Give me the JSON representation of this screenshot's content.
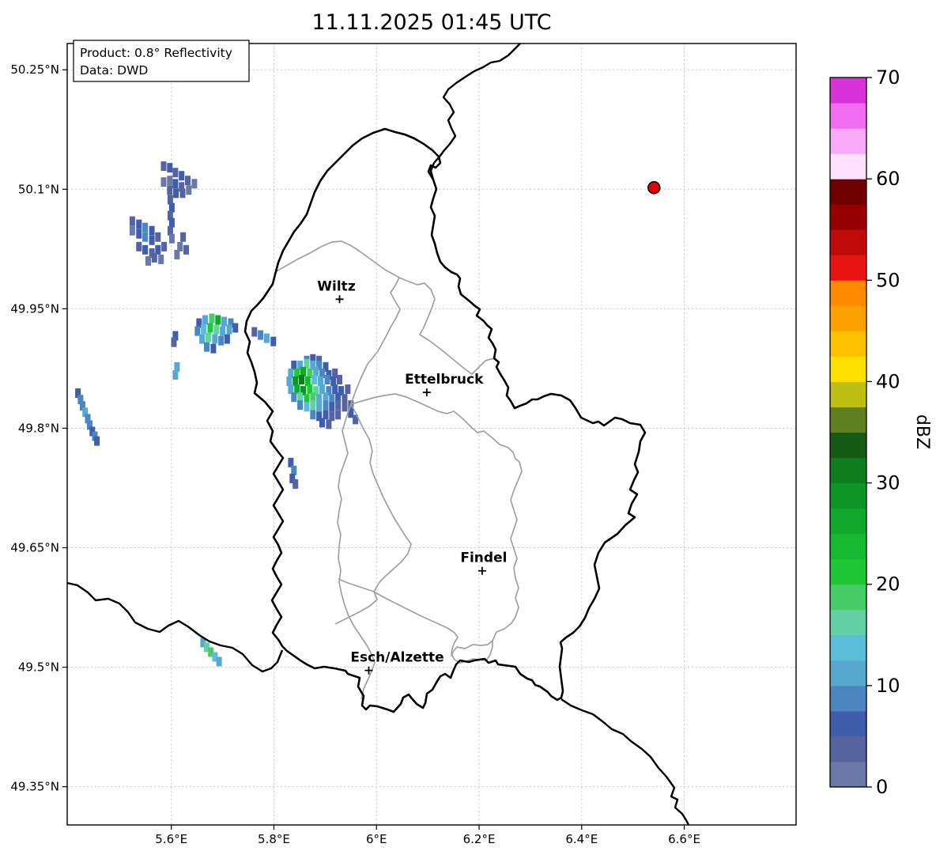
{
  "title": "11.11.2025 01:45 UTC",
  "info_box": {
    "line1": "Product: 0.8° Reflectivity",
    "line2": "Data: DWD"
  },
  "chart_data": {
    "type": "heatmap",
    "description": "Radar reflectivity map (0.8° elevation scan) over Luxembourg and surroundings",
    "axes": {
      "lon_range": [
        5.397,
        6.818
      ],
      "lat_range": [
        49.302,
        50.283
      ],
      "x_ticks": [
        {
          "value": 5.6,
          "label": "5.6°E"
        },
        {
          "value": 5.8,
          "label": "5.8°E"
        },
        {
          "value": 6.0,
          "label": "6°E"
        },
        {
          "value": 6.2,
          "label": "6.2°E"
        },
        {
          "value": 6.4,
          "label": "6.4°E"
        },
        {
          "value": 6.6,
          "label": "6.6°E"
        }
      ],
      "y_ticks": [
        {
          "value": 50.25,
          "label": "50.25°N"
        },
        {
          "value": 50.1,
          "label": "50.1°N"
        },
        {
          "value": 49.95,
          "label": "49.95°N"
        },
        {
          "value": 49.8,
          "label": "49.8°N"
        },
        {
          "value": 49.65,
          "label": "49.65°N"
        },
        {
          "value": 49.5,
          "label": "49.5°N"
        },
        {
          "value": 49.35,
          "label": "49.35°N"
        }
      ],
      "grid": true
    },
    "cities": [
      {
        "name": "Wiltz",
        "lon": 5.928,
        "lat": 49.962,
        "label_dx": -4
      },
      {
        "name": "Ettelbruck",
        "lon": 6.098,
        "lat": 49.845,
        "label_dx": 22
      },
      {
        "name": "Findel",
        "lon": 6.206,
        "lat": 49.621,
        "label_dx": 2
      },
      {
        "name": "Esch/Alzette",
        "lon": 5.985,
        "lat": 49.496,
        "label_dx": 36
      }
    ],
    "radar_site_marker": {
      "lon": 6.541,
      "lat": 50.102,
      "color": "#e60000"
    },
    "colorbar": {
      "label": "dBZ",
      "min": 0,
      "max": 70,
      "step": 2.5,
      "ticks": [
        0,
        10,
        20,
        30,
        40,
        50,
        60,
        70
      ],
      "colors_bottom_to_top": [
        "#6a78a8",
        "#55639e",
        "#3f5daa",
        "#4c86be",
        "#58a7cf",
        "#5cbdd9",
        "#63d1a3",
        "#47cc68",
        "#20c636",
        "#17b930",
        "#12a82c",
        "#0d9626",
        "#0f7d1e",
        "#155a15",
        "#5f7f20",
        "#bebe14",
        "#ffe100",
        "#ffc100",
        "#ffa100",
        "#ff8a00",
        "#e81414",
        "#c00a0a",
        "#960000",
        "#6e0000",
        "#fde1fd",
        "#f8a9f8",
        "#f06cf0",
        "#d932d9"
      ]
    },
    "echo_cells": [
      [
        5.585,
        50.129,
        4
      ],
      [
        5.597,
        50.127,
        6
      ],
      [
        5.608,
        50.121,
        4
      ],
      [
        5.62,
        50.117,
        6
      ],
      [
        5.632,
        50.111,
        4
      ],
      [
        5.597,
        50.111,
        2
      ],
      [
        5.608,
        50.107,
        6
      ],
      [
        5.62,
        50.103,
        4
      ],
      [
        5.585,
        50.109,
        2
      ],
      [
        5.597,
        50.099,
        4
      ],
      [
        5.609,
        50.095,
        6
      ],
      [
        5.622,
        50.095,
        4
      ],
      [
        5.634,
        50.099,
        2
      ],
      [
        5.645,
        50.107,
        2
      ],
      [
        5.598,
        50.087,
        4
      ],
      [
        5.601,
        50.077,
        6
      ],
      [
        5.598,
        50.067,
        4
      ],
      [
        5.601,
        50.058,
        6
      ],
      [
        5.598,
        50.048,
        4
      ],
      [
        5.601,
        50.038,
        2
      ],
      [
        5.524,
        50.06,
        4
      ],
      [
        5.537,
        50.056,
        6
      ],
      [
        5.549,
        50.052,
        8
      ],
      [
        5.562,
        50.048,
        6
      ],
      [
        5.537,
        50.044,
        6
      ],
      [
        5.549,
        50.04,
        8
      ],
      [
        5.562,
        50.036,
        6
      ],
      [
        5.574,
        50.04,
        4
      ],
      [
        5.524,
        50.048,
        2
      ],
      [
        5.537,
        50.028,
        4
      ],
      [
        5.549,
        50.024,
        6
      ],
      [
        5.562,
        50.02,
        4
      ],
      [
        5.574,
        50.024,
        6
      ],
      [
        5.586,
        50.028,
        4
      ],
      [
        5.567,
        50.014,
        4
      ],
      [
        5.555,
        50.01,
        2
      ],
      [
        5.58,
        50.012,
        2
      ],
      [
        5.623,
        50.04,
        4
      ],
      [
        5.617,
        50.028,
        2
      ],
      [
        5.629,
        50.024,
        4
      ],
      [
        5.611,
        50.018,
        2
      ],
      [
        5.654,
        49.932,
        6
      ],
      [
        5.666,
        49.936,
        10
      ],
      [
        5.679,
        49.938,
        18
      ],
      [
        5.691,
        49.936,
        26
      ],
      [
        5.703,
        49.934,
        12
      ],
      [
        5.716,
        49.932,
        8
      ],
      [
        5.651,
        49.922,
        8
      ],
      [
        5.663,
        49.924,
        14
      ],
      [
        5.676,
        49.926,
        22
      ],
      [
        5.688,
        49.924,
        16
      ],
      [
        5.7,
        49.922,
        12
      ],
      [
        5.713,
        49.924,
        10
      ],
      [
        5.725,
        49.926,
        6
      ],
      [
        5.66,
        49.912,
        10
      ],
      [
        5.672,
        49.914,
        16
      ],
      [
        5.685,
        49.912,
        12
      ],
      [
        5.697,
        49.91,
        8
      ],
      [
        5.709,
        49.912,
        6
      ],
      [
        5.669,
        49.902,
        8
      ],
      [
        5.682,
        49.9,
        6
      ],
      [
        5.774,
        49.917,
        8
      ],
      [
        5.786,
        49.913,
        12
      ],
      [
        5.799,
        49.909,
        6
      ],
      [
        5.762,
        49.921,
        4
      ],
      [
        5.608,
        49.916,
        6
      ],
      [
        5.605,
        49.908,
        4
      ],
      [
        5.611,
        49.877,
        10
      ],
      [
        5.608,
        49.867,
        12
      ],
      [
        5.864,
        49.885,
        8
      ],
      [
        5.876,
        49.887,
        6
      ],
      [
        5.888,
        49.885,
        4
      ],
      [
        5.839,
        49.879,
        6
      ],
      [
        5.851,
        49.879,
        12
      ],
      [
        5.864,
        49.881,
        16
      ],
      [
        5.876,
        49.879,
        10
      ],
      [
        5.888,
        49.879,
        8
      ],
      [
        5.901,
        49.877,
        6
      ],
      [
        5.833,
        49.869,
        10
      ],
      [
        5.845,
        49.869,
        22
      ],
      [
        5.857,
        49.871,
        26
      ],
      [
        5.87,
        49.869,
        18
      ],
      [
        5.882,
        49.871,
        10
      ],
      [
        5.894,
        49.869,
        8
      ],
      [
        5.907,
        49.867,
        6
      ],
      [
        5.919,
        49.869,
        4
      ],
      [
        5.83,
        49.859,
        12
      ],
      [
        5.842,
        49.859,
        28
      ],
      [
        5.854,
        49.861,
        30
      ],
      [
        5.866,
        49.859,
        24
      ],
      [
        5.879,
        49.861,
        14
      ],
      [
        5.891,
        49.859,
        10
      ],
      [
        5.904,
        49.861,
        8
      ],
      [
        5.916,
        49.859,
        6
      ],
      [
        5.928,
        49.861,
        4
      ],
      [
        5.833,
        49.849,
        10
      ],
      [
        5.845,
        49.849,
        26
      ],
      [
        5.857,
        49.847,
        28
      ],
      [
        5.87,
        49.849,
        20
      ],
      [
        5.882,
        49.847,
        16
      ],
      [
        5.894,
        49.849,
        12
      ],
      [
        5.907,
        49.847,
        8
      ],
      [
        5.919,
        49.849,
        6
      ],
      [
        5.931,
        49.847,
        6
      ],
      [
        5.944,
        49.849,
        4
      ],
      [
        5.839,
        49.839,
        8
      ],
      [
        5.851,
        49.839,
        16
      ],
      [
        5.864,
        49.837,
        22
      ],
      [
        5.876,
        49.839,
        18
      ],
      [
        5.888,
        49.837,
        12
      ],
      [
        5.901,
        49.839,
        10
      ],
      [
        5.913,
        49.837,
        8
      ],
      [
        5.925,
        49.839,
        6
      ],
      [
        5.938,
        49.837,
        4
      ],
      [
        5.851,
        49.829,
        8
      ],
      [
        5.864,
        49.827,
        14
      ],
      [
        5.876,
        49.829,
        16
      ],
      [
        5.888,
        49.827,
        10
      ],
      [
        5.901,
        49.829,
        8
      ],
      [
        5.913,
        49.827,
        6
      ],
      [
        5.925,
        49.829,
        4
      ],
      [
        5.938,
        49.827,
        4
      ],
      [
        5.95,
        49.829,
        4
      ],
      [
        5.876,
        49.817,
        8
      ],
      [
        5.888,
        49.815,
        6
      ],
      [
        5.901,
        49.817,
        6
      ],
      [
        5.913,
        49.815,
        4
      ],
      [
        5.925,
        49.817,
        4
      ],
      [
        5.95,
        49.819,
        6
      ],
      [
        5.959,
        49.811,
        4
      ],
      [
        5.894,
        49.807,
        6
      ],
      [
        5.907,
        49.805,
        4
      ],
      [
        5.418,
        49.844,
        6
      ],
      [
        5.423,
        49.836,
        8
      ],
      [
        5.427,
        49.828,
        8
      ],
      [
        5.432,
        49.82,
        10
      ],
      [
        5.437,
        49.812,
        8
      ],
      [
        5.441,
        49.804,
        8
      ],
      [
        5.446,
        49.796,
        6
      ],
      [
        5.451,
        49.79,
        8
      ],
      [
        5.455,
        49.784,
        6
      ],
      [
        5.833,
        49.757,
        6
      ],
      [
        5.839,
        49.747,
        8
      ],
      [
        5.836,
        49.737,
        6
      ],
      [
        5.842,
        49.73,
        4
      ],
      [
        5.662,
        49.531,
        12
      ],
      [
        5.669,
        49.525,
        16
      ],
      [
        5.677,
        49.519,
        18
      ],
      [
        5.685,
        49.513,
        14
      ],
      [
        5.693,
        49.507,
        10
      ]
    ]
  }
}
